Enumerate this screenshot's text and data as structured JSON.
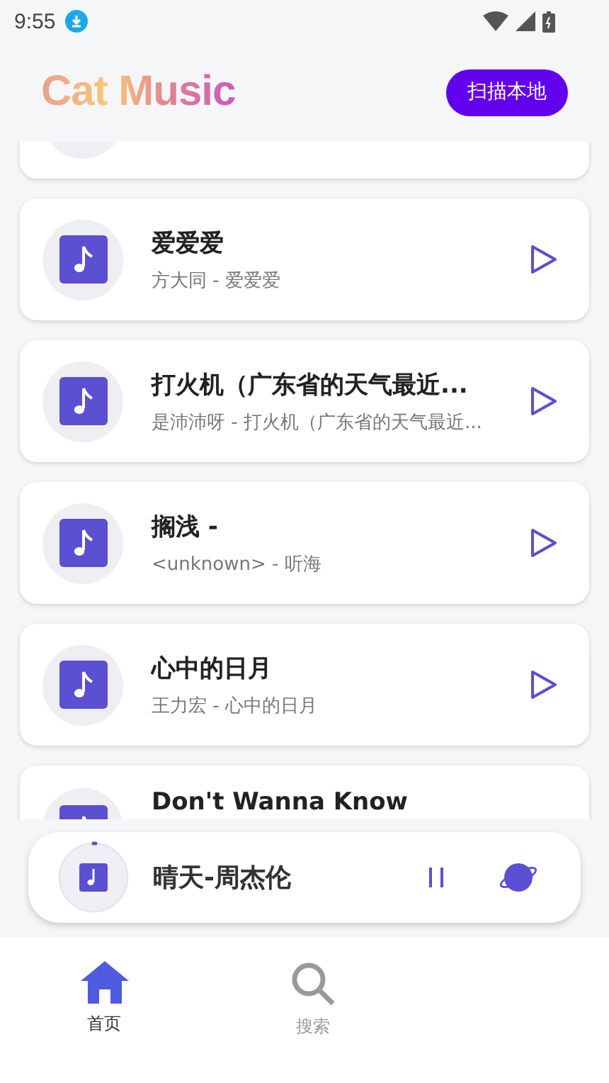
{
  "status_bar": {
    "time": "9:55"
  },
  "header": {
    "title": "Cat Music",
    "scan_button": "扫描本地"
  },
  "songs": [
    {
      "kind": "partial"
    },
    {
      "kind": "full",
      "title": "爱爱爱",
      "subtitle": "方大同 - 爱爱爱"
    },
    {
      "kind": "full",
      "title": "打火机（广东省的天气最近...",
      "subtitle": "是沛沛呀 - 打火机（广东省的天气最近..."
    },
    {
      "kind": "full",
      "title": "搁浅 -",
      "subtitle": "<unknown> - 听海"
    },
    {
      "kind": "full",
      "title": "心中的日月",
      "subtitle": "王力宏 - 心中的日月"
    },
    {
      "kind": "cut",
      "title": "Don't Wanna Know"
    }
  ],
  "player": {
    "title": "晴天-周杰伦",
    "level": 0.01,
    "playing": true
  },
  "nav": [
    {
      "label": "首页",
      "selected": true,
      "kind": "home"
    },
    {
      "label": "搜索",
      "selected": false,
      "kind": "search"
    }
  ]
}
